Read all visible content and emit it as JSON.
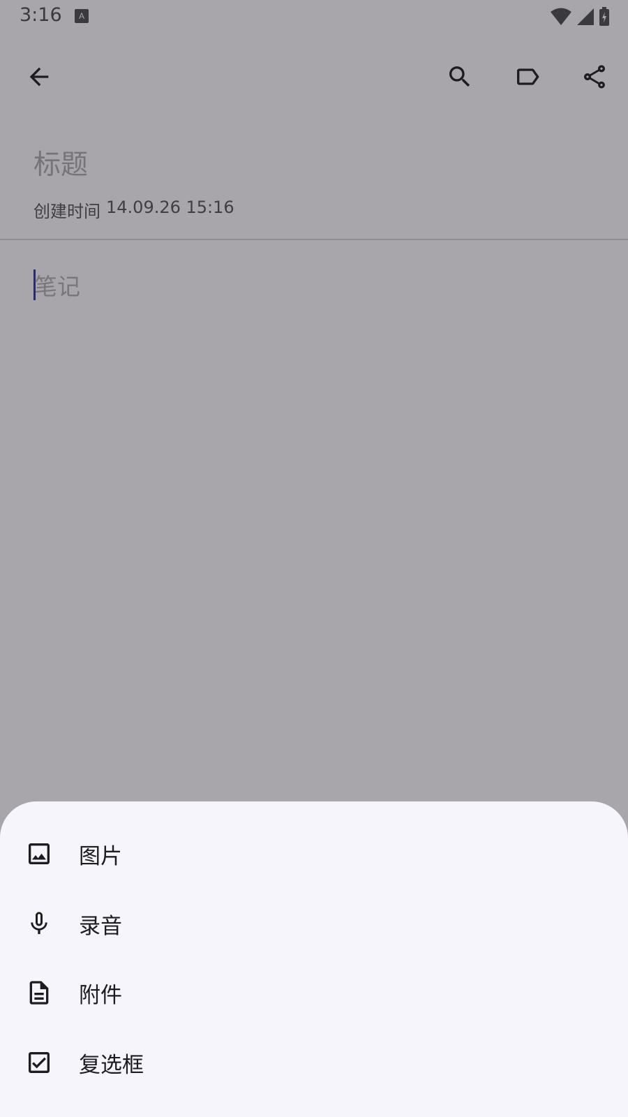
{
  "status_bar": {
    "time": "3:16",
    "icons": [
      "keyboard-a-icon",
      "wifi-icon",
      "signal-icon",
      "battery-charging-icon"
    ]
  },
  "toolbar": {
    "back_icon": "arrow-left-icon",
    "search_icon": "search-icon",
    "label_icon": "label-tag-icon",
    "share_icon": "share-icon"
  },
  "note": {
    "title_placeholder": "标题",
    "created_label": "创建时间",
    "created_value": "14.09.26 15:16",
    "body_placeholder": "笔记"
  },
  "attach_sheet": {
    "items": [
      {
        "label": "图片",
        "icon": "image-icon"
      },
      {
        "label": "录音",
        "icon": "microphone-icon"
      },
      {
        "label": "附件",
        "icon": "document-icon"
      },
      {
        "label": "复选框",
        "icon": "checkbox-icon"
      }
    ]
  },
  "colors": {
    "scrim": "#a8a6aa",
    "sheet_bg": "#f6f5fc",
    "text_primary": "#1d1c20",
    "cursor": "#2b2a6a"
  }
}
